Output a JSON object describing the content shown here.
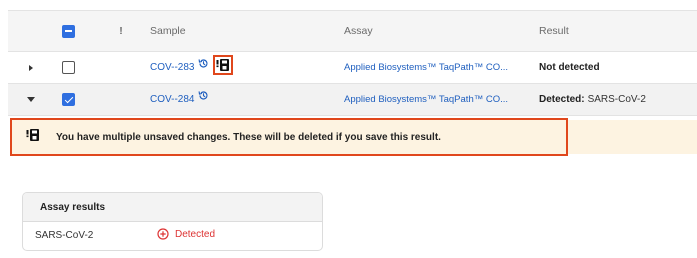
{
  "table": {
    "headers": {
      "flag": "!",
      "sample": "Sample",
      "assay": "Assay",
      "result": "Result"
    },
    "rows": [
      {
        "sample": "COV--283",
        "assay": "Applied Biosystems™ TaqPath™ CO...",
        "result_label": "Not detected",
        "result_value": "",
        "checked": false,
        "expanded": false
      },
      {
        "sample": "COV--284",
        "assay": "Applied Biosystems™ TaqPath™ CO...",
        "result_label": "Detected:",
        "result_value": "SARS-CoV-2",
        "checked": true,
        "expanded": true
      }
    ]
  },
  "banner": {
    "message": "You have multiple unsaved changes. These will be deleted if you save this result.",
    "icon": "unsaved-changes-icon",
    "background": "#fdf3e1",
    "highlight": "#e0471c"
  },
  "assay_results": {
    "title": "Assay results",
    "items": [
      {
        "target": "SARS-CoV-2",
        "status": "Detected"
      }
    ]
  },
  "colors": {
    "accent": "#2f6fe0",
    "link": "#1f5fbf",
    "detected": "#d33333"
  }
}
